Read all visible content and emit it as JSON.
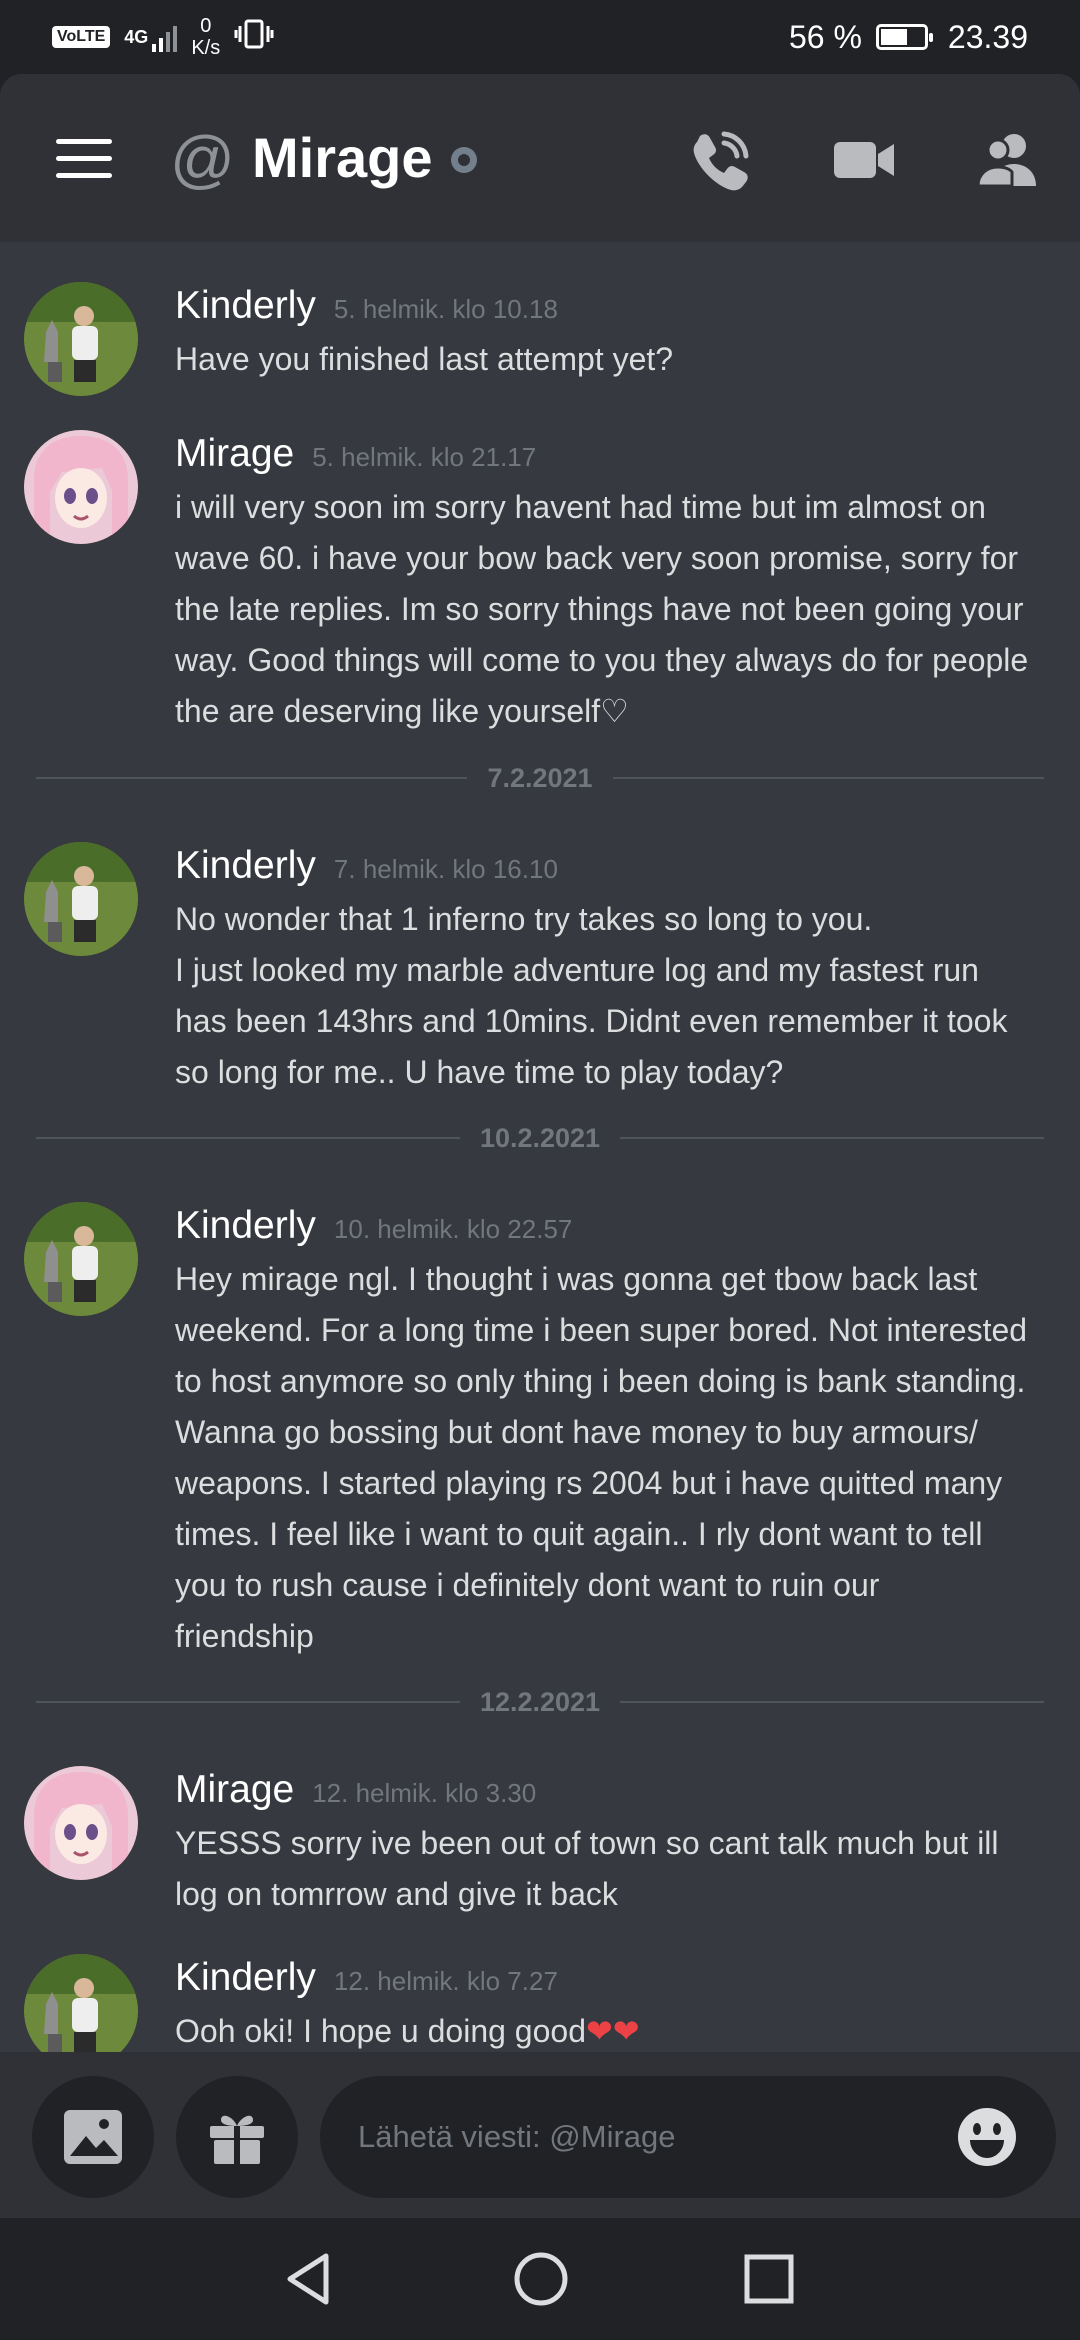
{
  "status_bar": {
    "network_type": "VoLTE",
    "network_gen": "4G",
    "net_speed_value": "0",
    "net_speed_unit": "K/s",
    "battery_percent": "56 %",
    "battery_level": 0.56,
    "clock": "23.39"
  },
  "header": {
    "at_symbol": "@",
    "title": "Mirage",
    "icons": [
      "menu-icon",
      "at-icon",
      "status-dot-icon",
      "voice-call-icon",
      "video-call-icon",
      "members-icon"
    ]
  },
  "messages": [
    {
      "author": "Kinderly",
      "time": "5. helmik. klo 10.18",
      "lines": [
        "Have you finished last attempt yet?"
      ]
    },
    {
      "author": "Mirage",
      "time": "5. helmik. klo 21.17",
      "lines": [
        "i will very soon im sorry havent had time but im almost on",
        "wave 60. i have your bow back very soon promise, sorry for",
        "the late replies. Im so sorry things have not been going your",
        "way. Good things will come to you they always do for people",
        "the are deserving like yourself♡"
      ]
    },
    {
      "author": "Kinderly",
      "time": "7. helmik. klo 16.10",
      "lines": [
        "No wonder that 1 inferno try takes so long to you.",
        "I just looked my marble adventure log and my fastest run",
        "has been 143hrs and 10mins. Didnt even remember it took",
        "so long for me.. U have time to play today?"
      ]
    },
    {
      "author": "Kinderly",
      "time": "10. helmik. klo 22.57",
      "lines": [
        "Hey mirage ngl. I thought i was gonna get tbow back last",
        "weekend. For a long time i been super bored. Not interested",
        "to host anymore so only thing i been doing is bank standing.",
        "Wanna go bossing but dont have money to buy armours/",
        "weapons. I started playing rs 2004 but i have quitted many",
        "times. I feel like i want to quit again.. I rly dont want to tell",
        "you to rush cause i definitely dont want to ruin our",
        "friendship"
      ]
    },
    {
      "author": "Mirage",
      "time": "12. helmik. klo 3.30",
      "lines": [
        "YESSS sorry ive been out of town so cant talk much but ill",
        "log on tomrrow and give it back"
      ]
    },
    {
      "author": "Kinderly",
      "time": "12. helmik. klo 7.27",
      "lines": [
        "Ooh oki! I hope u doing good"
      ],
      "emoji": "❤❤"
    }
  ],
  "dividers": [
    "7.2.2021",
    "10.2.2021",
    "12.2.2021"
  ],
  "composer": {
    "placeholder": "Lähetä viesti: @Mirage",
    "icons": [
      "image-icon",
      "gift-icon",
      "emoji-icon"
    ]
  },
  "nav": {
    "icons": [
      "back-icon",
      "home-icon",
      "recents-icon"
    ]
  },
  "colors": {
    "background": "#36393f",
    "header": "#2f3136",
    "status_bar": "#202225",
    "text": "#dcddde",
    "timestamp": "#72767d",
    "heart": "#ed4245"
  }
}
